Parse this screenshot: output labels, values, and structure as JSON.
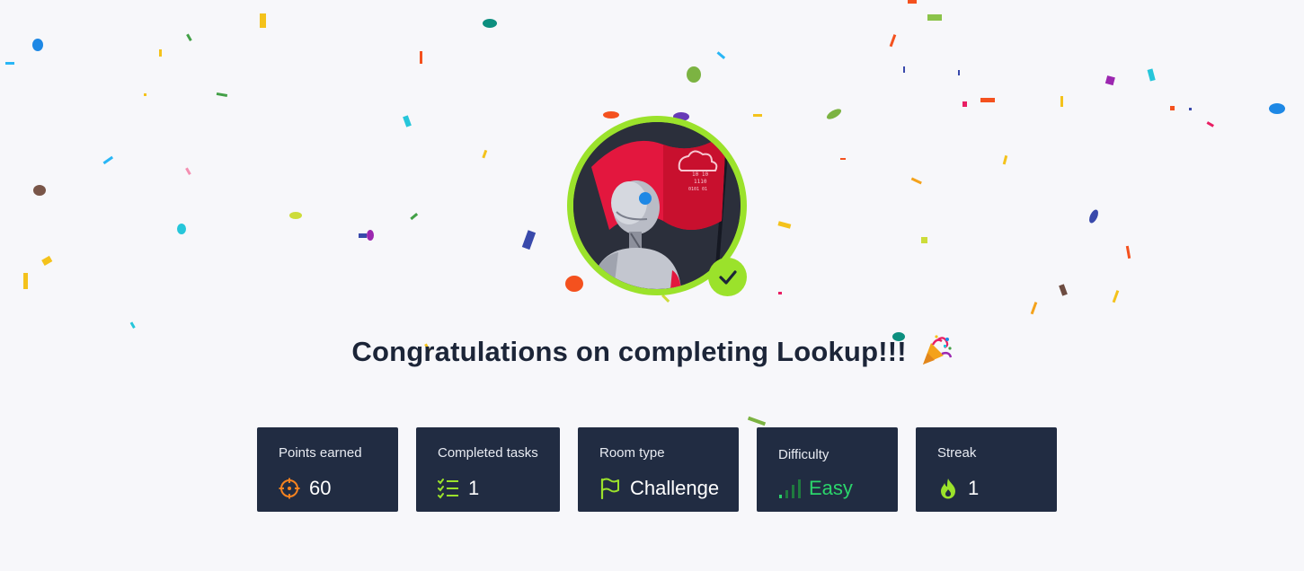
{
  "heading": {
    "title": "Congratulations on completing Lookup!!!",
    "emoji": "party-popper-icon"
  },
  "badge": {
    "image": "robot-holding-red-flag-illustration",
    "status_icon": "checkmark-icon",
    "ring_color": "#9be22b"
  },
  "stats": [
    {
      "label": "Points earned",
      "value": "60",
      "icon": "crosshair-icon",
      "icon_color": "#f5821f"
    },
    {
      "label": "Completed tasks",
      "value": "1",
      "icon": "checklist-icon",
      "icon_color": "#9be22b"
    },
    {
      "label": "Room type",
      "value": "Challenge",
      "icon": "flag-icon",
      "icon_color": "#9be22b"
    },
    {
      "label": "Difficulty",
      "value": "Easy",
      "icon": "signal-bars-icon",
      "icon_color": "#2bd46b"
    },
    {
      "label": "Streak",
      "value": "1",
      "icon": "flame-icon",
      "icon_color": "#9be22b"
    }
  ],
  "colors": {
    "background": "#f7f7fa",
    "card": "#212c42",
    "accent": "#9be22b",
    "heading_text": "#1c2538"
  }
}
